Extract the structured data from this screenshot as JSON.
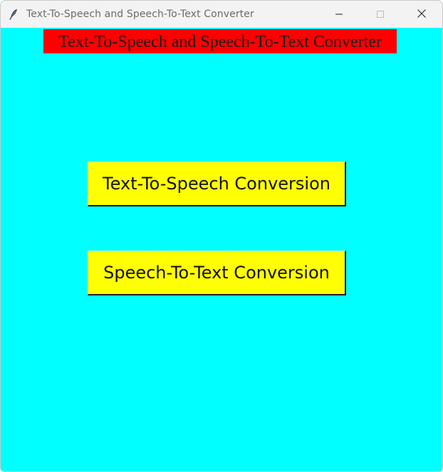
{
  "window": {
    "title": "Text-To-Speech and Speech-To-Text Converter",
    "app_icon": "feather-icon",
    "controls": [
      "minimize-icon",
      "maximize-icon",
      "close-icon"
    ]
  },
  "main": {
    "heading": "Text-To-Speech and Speech-To-Text Converter",
    "buttons": [
      {
        "label": "Text-To-Speech Conversion"
      },
      {
        "label": "Speech-To-Text Conversion"
      }
    ]
  },
  "colors": {
    "background": "#00ffff",
    "heading_background": "#ff0000",
    "button_background": "#ffff00"
  }
}
